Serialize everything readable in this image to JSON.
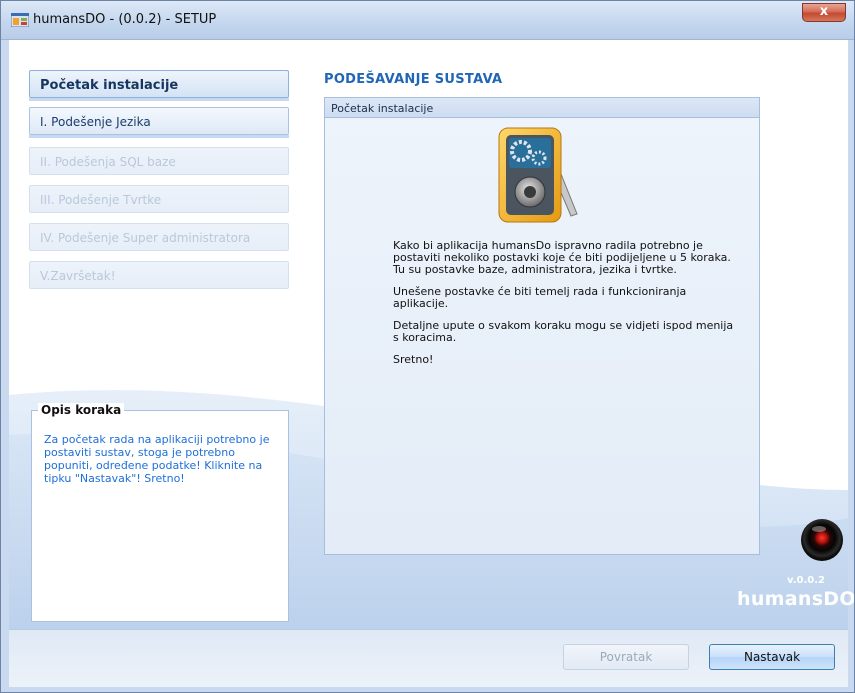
{
  "window": {
    "title": "humansDO - (0.0.2) - SETUP",
    "close_symbol": "x"
  },
  "steps": [
    {
      "label": "Početak instalacije",
      "state": "active"
    },
    {
      "label": "I. Podešenje Jezika",
      "state": "enabled"
    },
    {
      "label": "II. Podešenja SQL baze",
      "state": "disabled"
    },
    {
      "label": "III. Podešenje Tvrtke",
      "state": "disabled"
    },
    {
      "label": "IV. Podešenje Super administratora",
      "state": "disabled"
    },
    {
      "label": "V.Završetak!",
      "state": "disabled"
    }
  ],
  "description": {
    "title": "Opis koraka",
    "text": "Za početak rada na aplikaciji potrebno je postaviti sustav, stoga je potrebno popuniti, određene podatke! Kliknite na tipku \"Nastavak\"! Sretno!"
  },
  "main": {
    "section_title": "PODEŠAVANJE SUSTAVA",
    "panel_header": "Početak instalacije",
    "image_icon": "device-settings-icon",
    "paragraphs": [
      "Kako bi aplikacija humansDo ispravno radila potrebno je postaviti nekoliko postavki koje će biti podijeljene u 5 koraka. Tu su postavke baze, administratora, jezika i tvrtke.",
      "Unešene postavke će biti temelj rada i funkcioniranja aplikacije.",
      "Detaljne upute o svakom koraku mogu se vidjeti ispod menija s koracima.",
      "Sretno!"
    ]
  },
  "branding": {
    "version": "v.0.0.2",
    "name": "humansDO"
  },
  "buttons": {
    "back": "Povratak",
    "next": "Nastavak"
  },
  "colors": {
    "accent": "#1f66b8",
    "description_text": "#1e6fd9"
  }
}
